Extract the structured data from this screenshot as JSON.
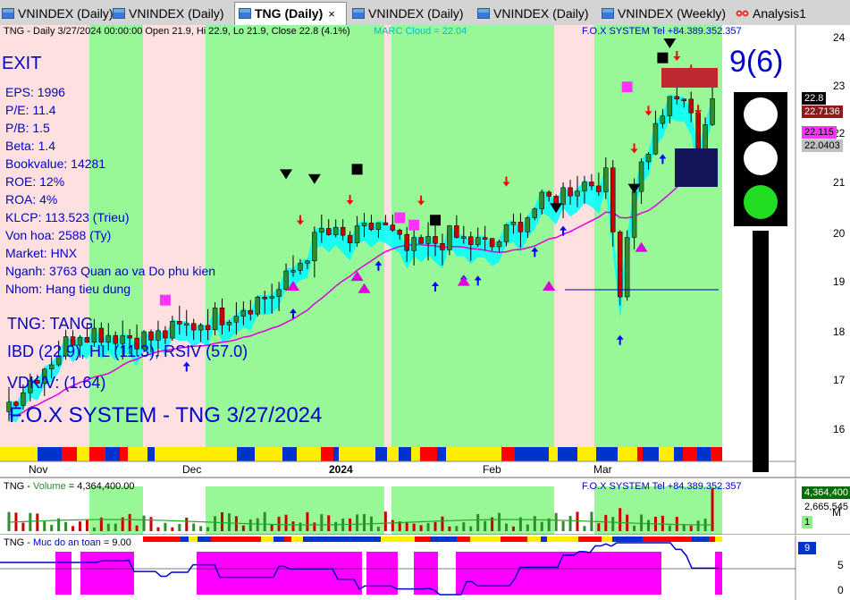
{
  "tabs": [
    {
      "label": "VNINDEX (Daily)",
      "active": false
    },
    {
      "label": "VNINDEX (Daily)",
      "active": false
    },
    {
      "label": "TNG (Daily)",
      "active": true
    },
    {
      "label": "VNINDEX (Daily)",
      "active": false
    },
    {
      "label": "VNINDEX (Daily)",
      "active": false
    },
    {
      "label": "VNINDEX (Weekly)",
      "active": false
    },
    {
      "label": "Analysis1",
      "active": false
    }
  ],
  "tab_close": "×",
  "price_pane": {
    "header": "TNG - Daily 3/27/2024 00:00:00 Open 21.9, Hi 22.9, Lo 21.9, Close 22.8 (4.1%)",
    "marc_cloud": "MARC Cloud = 22.04",
    "fox_tel": "F.O.X SYSTEM Tel +84.389.352.357",
    "signal": "EXIT",
    "stats": [
      "EPS: 1996",
      "P/E: 11.4",
      "P/B: 1.5",
      "Beta: 1.4",
      "Bookvalue: 14281",
      "ROE: 12%",
      "ROA: 4%",
      "KLCP: 113.523 (Trieu)",
      "Von hoa: 2588 (Ty)",
      "Market: HNX",
      "Nganh: 3763 Quan ao va Do phu kien",
      "Nhom: Hang tieu dung"
    ],
    "ticker_line": "TNG: TANG",
    "ibd_line": "IBD (22.9), HL (11.3), RSIV (57.0)",
    "vdk_line": "VDK/V:  (1.64)",
    "watermark": "F.O.X SYSTEM - TNG 3/27/2024",
    "score": "9(6)",
    "traffic_light": [
      "white",
      "white",
      "#22dd22"
    ],
    "yticks": [
      "24",
      "23",
      "22",
      "21",
      "20",
      "19",
      "18",
      "17",
      "16"
    ],
    "xticks": [
      "Nov",
      "Dec",
      "2024",
      "Feb",
      "Mar"
    ],
    "value_boxes": [
      {
        "text": "22.8",
        "bg": "#000000",
        "fg": "#ffffff"
      },
      {
        "text": "22.7136",
        "bg": "#8b1a1a",
        "fg": "#ffffff"
      },
      {
        "text": "22.115",
        "bg": "#ff33ff",
        "fg": "#000000"
      },
      {
        "text": "22.0403",
        "bg": "#c0c0c0",
        "fg": "#000000"
      }
    ]
  },
  "volume_pane": {
    "title": "TNG",
    "label": "Volume",
    "value": "= 4,364,400.00",
    "fox_tel": "F.O.X SYSTEM Tel +84.389.352.357",
    "value_boxes": [
      {
        "text": "4,364,400",
        "bg": "#0a6b0a",
        "fg": "#ffffff"
      },
      {
        "text": "2,665,545",
        "bg": "#ffffff",
        "fg": "#000000"
      },
      {
        "text": "1",
        "bg": "#90ee90",
        "fg": "#000000"
      }
    ],
    "unit": "M"
  },
  "safety_pane": {
    "title": "TNG",
    "label": "Muc do an toan",
    "value": "= 9.00",
    "yticks": [
      "5",
      "0"
    ],
    "value_box": {
      "text": "9",
      "bg": "#0033cc",
      "fg": "#ffffff"
    }
  },
  "colors": {
    "green_zone": "#98f898",
    "pink_zone": "#ffe0e0",
    "up_candle": "#2e8b2e",
    "down_candle": "#cc0000",
    "cloud": "#00ffff",
    "magenta": "#dd00dd",
    "blue": "#0000ff",
    "red": "#ff0000"
  }
}
